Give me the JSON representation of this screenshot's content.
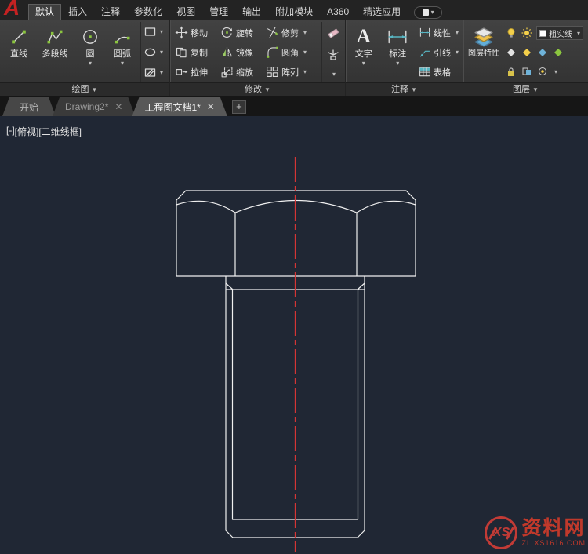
{
  "colors": {
    "outline": "#f0f0f0",
    "centerline": "#d43535",
    "canvas_bg": "#202734"
  },
  "titlebar": {
    "logo": "A",
    "tabs": [
      {
        "label": "默认"
      },
      {
        "label": "插入"
      },
      {
        "label": "注释"
      },
      {
        "label": "参数化"
      },
      {
        "label": "视图"
      },
      {
        "label": "管理"
      },
      {
        "label": "输出"
      },
      {
        "label": "附加模块"
      },
      {
        "label": "A360"
      },
      {
        "label": "精选应用"
      }
    ]
  },
  "ribbon": {
    "draw": {
      "title": "绘图",
      "line": "直线",
      "polyline": "多段线",
      "circle": "圆",
      "arc": "圆弧"
    },
    "modify": {
      "title": "修改",
      "move": "移动",
      "rotate": "旋转",
      "trim": "修剪",
      "copy": "复制",
      "mirror": "镜像",
      "fillet": "圆角",
      "stretch": "拉伸",
      "scale": "缩放",
      "array": "阵列"
    },
    "annotate": {
      "title": "注释",
      "text": "文字",
      "text_icon": "A",
      "dimension": "标注",
      "linear": "线性",
      "leader": "引线",
      "table": "表格"
    },
    "layers": {
      "title": "图层",
      "properties": "图层特性",
      "current_layer": "粗实线"
    }
  },
  "file_tabs": {
    "start": "开始",
    "drawing2": "Drawing2*",
    "document1": "工程图文档1*"
  },
  "viewport": {
    "controls": "[-]",
    "view": "[俯视]",
    "visual_style": "[二维线框]"
  },
  "watermark": {
    "logo_text": "XS",
    "site_name": "资料网",
    "site_url": "ZL.XS1616.COM"
  }
}
